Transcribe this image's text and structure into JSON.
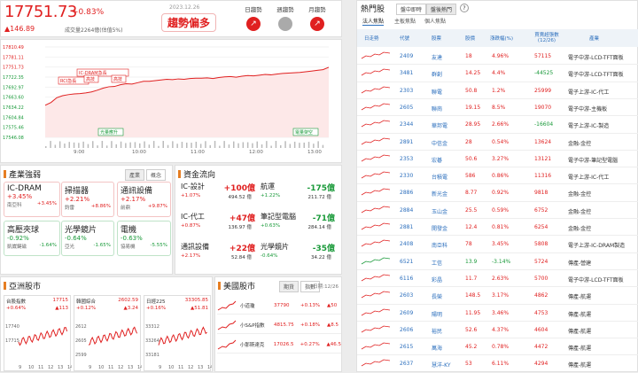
{
  "header": {
    "price": "17751.73",
    "pct": "+0.83%",
    "change": "▲146.89",
    "volume": "成交量2264億(估值5%)",
    "date": "2023.12.26",
    "trend": "趨勢偏多",
    "timeframes": [
      {
        "label": "日趨勢",
        "color": "#e02020",
        "icon": "up"
      },
      {
        "label": "週趨勢",
        "color": "#aaaaaa",
        "icon": "flat"
      },
      {
        "label": "月趨勢",
        "color": "#e02020",
        "icon": "up"
      }
    ]
  },
  "chart_data": {
    "type": "line",
    "yticks": [
      "17810.49",
      "17781.11",
      "17751.73",
      "17722.35",
      "17692.97",
      "17663.60",
      "17634.22",
      "17604.84",
      "17575.46",
      "17546.08"
    ],
    "xticks": [
      "9:00",
      "10:00",
      "11:00",
      "12:00",
      "13:00"
    ],
    "annotations": [
      "RCI急長",
      "IC-DRAM急長",
      "高技",
      "高技",
      "光量應升",
      "電量架空"
    ],
    "series": [
      {
        "values": [
          17640,
          17648,
          17662,
          17668,
          17671,
          17673,
          17674,
          17676,
          17679,
          17684,
          17690,
          17694,
          17695,
          17700,
          17703,
          17702,
          17706,
          17710,
          17710,
          17712,
          17714,
          17716,
          17715,
          17717,
          17716,
          17718,
          17719,
          17719,
          17720,
          17718,
          17721,
          17723,
          17724,
          17722,
          17725,
          17727,
          17726,
          17728,
          17730,
          17729,
          17731,
          17733,
          17734,
          17735,
          17736,
          17738,
          17740,
          17742,
          17744,
          17751
        ]
      }
    ],
    "ylim": [
      17546.08,
      17810.49
    ]
  },
  "sector": {
    "title": "產業強弱",
    "tabs": [
      "產業",
      "概念"
    ],
    "cards": [
      {
        "name": "IC-DRAM",
        "pct": "+3.45%",
        "lead": "南亞科",
        "lead_pct": "+3.45%",
        "color": "red"
      },
      {
        "name": "掃描器",
        "pct": "+2.21%",
        "lead": "鈞雷",
        "lead_pct": "+8.86%",
        "color": "red"
      },
      {
        "name": "通訊設備",
        "pct": "+2.17%",
        "lead": "前鼎",
        "lead_pct": "+9.87%",
        "color": "red"
      },
      {
        "name": "高壓夾球",
        "pct": "-0.92%",
        "lead": "凱崴鍵磁",
        "lead_pct": "-1.64%",
        "color": "green"
      },
      {
        "name": "光學鏡片",
        "pct": "-0.64%",
        "lead": "亞光",
        "lead_pct": "-1.65%",
        "color": "green"
      },
      {
        "name": "電機",
        "pct": "-0.63%",
        "lead": "協易機",
        "lead_pct": "-5.55%",
        "color": "green"
      }
    ]
  },
  "flow": {
    "title": "資金流向",
    "items": [
      {
        "name": "IC-設計",
        "val": "+100億",
        "pct": "+1.07%",
        "amt": "494.52 億",
        "color": "red"
      },
      {
        "name": "航運",
        "val": "-175億",
        "pct": "+1.22%",
        "amt": "211.72 億",
        "color": "green"
      },
      {
        "name": "IC-代工",
        "val": "+47億",
        "pct": "+0.87%",
        "amt": "136.97 億",
        "color": "red"
      },
      {
        "name": "筆記型電腦",
        "val": "-71億",
        "pct": "+0.63%",
        "amt": "284.14 億",
        "color": "green"
      },
      {
        "name": "通訊設備",
        "val": "+22億",
        "pct": "+2.17%",
        "amt": "52.84 億",
        "color": "red"
      },
      {
        "name": "光學鏡片",
        "val": "-35億",
        "pct": "-0.64%",
        "amt": "34.22 億",
        "color": "green"
      }
    ]
  },
  "asia": {
    "title": "亞洲股市",
    "items": [
      {
        "name": "台股指數",
        "val": "17715",
        "pct": "+0.64%",
        "ch": "▲113",
        "y": [
          "17740",
          "17715"
        ],
        "x": [
          "9",
          "10",
          "11",
          "12",
          "13",
          "14"
        ]
      },
      {
        "name": "韓國綜合",
        "val": "2602.59",
        "pct": "+0.12%",
        "ch": "▲3.24",
        "y": [
          "2612",
          "2605",
          "2599"
        ],
        "x": [
          "9",
          "10",
          "11",
          "12",
          "13",
          "14"
        ]
      },
      {
        "name": "日經225",
        "val": "33305.85",
        "pct": "+0.16%",
        "ch": "▲51.81",
        "y": [
          "33312",
          "33264",
          "33181"
        ],
        "x": [
          "9",
          "10",
          "11",
          "12",
          "13",
          "14"
        ]
      }
    ]
  },
  "us": {
    "title": "美國股市",
    "tabs": [
      "期貨",
      "指數"
    ],
    "date": "日期:12/26",
    "rows": [
      {
        "name": "小道瓊",
        "val": "37790",
        "pct": "+0.13%",
        "ch": "▲50"
      },
      {
        "name": "小S&P指數",
        "val": "4815.75",
        "pct": "+0.18%",
        "ch": "▲8.5"
      },
      {
        "name": "小那斯達克",
        "val": "17026.5",
        "pct": "+0.27%",
        "ch": "▲46.5"
      }
    ]
  },
  "hot": {
    "title": "熱門股",
    "tabs": [
      "盤中即時",
      "盤後熱門"
    ],
    "subtabs": [
      "法人焦點",
      "主板焦點",
      "個人焦點"
    ],
    "columns": [
      "日走勢",
      "代號",
      "股票",
      "股價",
      "漲跌幅(%)",
      "買賣超張數(12/26)",
      "產業"
    ],
    "rows": [
      [
        "2409",
        "友達",
        "18",
        "4.96%",
        "57115",
        "電子中游-LCD-TFT面板"
      ],
      [
        "3481",
        "群創",
        "14.25",
        "4.4%",
        "-44525",
        "電子中游-LCD-TFT面板"
      ],
      [
        "2303",
        "聯電",
        "50.8",
        "1.2%",
        "25999",
        "電子上游-IC-代工"
      ],
      [
        "2605",
        "聯崗",
        "19.15",
        "8.5%",
        "19070",
        "電子中游-主機板"
      ],
      [
        "2344",
        "華邦電",
        "28.95",
        "2.66%",
        "-16604",
        "電子上游-IC-製造"
      ],
      [
        "2891",
        "中信金",
        "28",
        "0.54%",
        "13624",
        "金融-金控"
      ],
      [
        "2353",
        "宏碁",
        "50.6",
        "3.27%",
        "13121",
        "電子中游-筆記型電腦"
      ],
      [
        "2330",
        "台積電",
        "586",
        "0.86%",
        "11316",
        "電子上游-IC-代工"
      ],
      [
        "2886",
        "新光金",
        "8.77",
        "0.92%",
        "9818",
        "金融-金控"
      ],
      [
        "2884",
        "玉山金",
        "25.5",
        "0.59%",
        "6752",
        "金融-金控"
      ],
      [
        "2881",
        "開發金",
        "12.4",
        "0.81%",
        "6254",
        "金融-金控"
      ],
      [
        "2408",
        "南亞科",
        "78",
        "3.45%",
        "5808",
        "電子上游-IC-DRAM製造"
      ],
      [
        "6521",
        "工信",
        "13.9",
        "-3.14%",
        "5724",
        "傳產-營建"
      ],
      [
        "6116",
        "彩晶",
        "11.7",
        "2.63%",
        "5700",
        "電子中游-LCD-TFT面板"
      ],
      [
        "2603",
        "長榮",
        "148.5",
        "3.17%",
        "4862",
        "傳產-航運"
      ],
      [
        "2609",
        "陽明",
        "11.95",
        "3.46%",
        "4753",
        "傳產-航運"
      ],
      [
        "2606",
        "裕民",
        "52.6",
        "4.37%",
        "4604",
        "傳產-航運"
      ],
      [
        "2615",
        "萬海",
        "45.2",
        "0.78%",
        "4472",
        "傳產-航運"
      ],
      [
        "2637",
        "慧洋-KY",
        "53",
        "6.11%",
        "4294",
        "傳產-航運"
      ]
    ]
  }
}
